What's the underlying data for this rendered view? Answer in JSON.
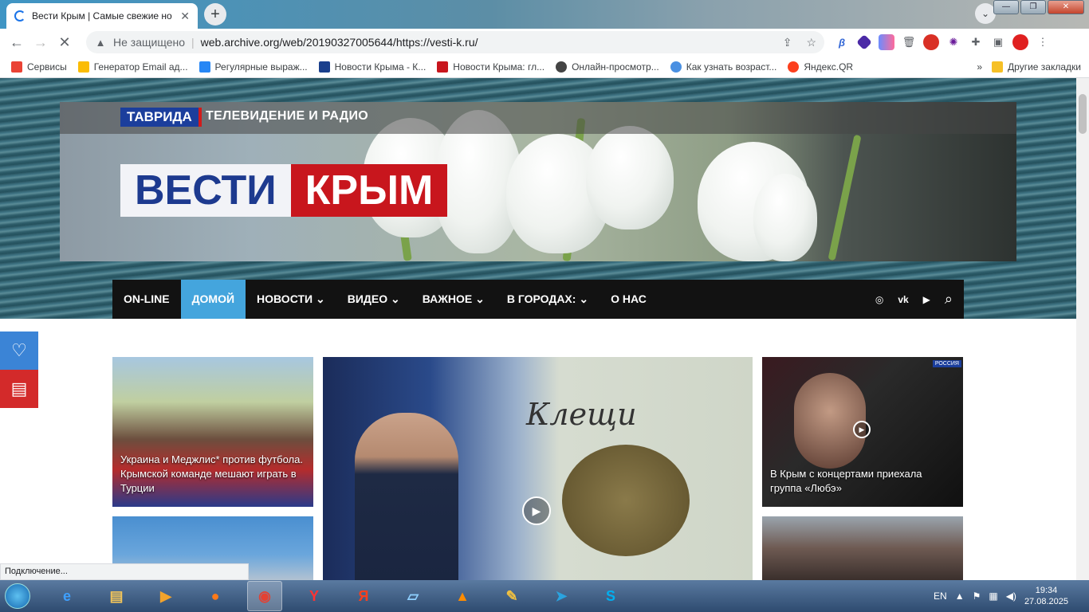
{
  "browser": {
    "tab_title": "Вести Крым | Самые свежие но",
    "address_warning": "Не защищено",
    "url": "web.archive.org/web/20190327005644/https://vesti-k.ru/",
    "status": "Подключение..."
  },
  "bookmarks": {
    "items": [
      {
        "label": "Сервисы",
        "color": "#ea4335"
      },
      {
        "label": "Генератор Email ад...",
        "color": "#fbbc05"
      },
      {
        "label": "Регулярные выраж...",
        "color": "#2787f5"
      },
      {
        "label": "Новости Крыма - К...",
        "color": "#1a3f8c"
      },
      {
        "label": "Новости Крыма: гл...",
        "color": "#c8161d"
      },
      {
        "label": "Онлайн-просмотр...",
        "color": "#444444"
      },
      {
        "label": "Как узнать возраст...",
        "color": "#4a90e2"
      },
      {
        "label": "Яндекс.QR",
        "color": "#fc3f1d"
      }
    ],
    "more": "»",
    "other": "Другие закладки"
  },
  "site": {
    "brand_taurida": "ТАВРИДА",
    "brand_tv": "ТЕЛЕВИДЕНИЕ И РАДИО",
    "logo_vesti": "ВЕСТИ",
    "logo_krym": "КРЫМ",
    "menu": [
      {
        "label": "ON-LINE",
        "dropdown": ""
      },
      {
        "label": "ДОМОЙ",
        "dropdown": ""
      },
      {
        "label": "НОВОСТИ",
        "dropdown": "⌄"
      },
      {
        "label": "ВИДЕО",
        "dropdown": "⌄"
      },
      {
        "label": "ВАЖНОЕ",
        "dropdown": "⌄"
      },
      {
        "label": "В ГОРОДАХ:",
        "dropdown": "⌄"
      },
      {
        "label": "О НАС",
        "dropdown": ""
      }
    ],
    "main_video_text": "Клещи",
    "cards": {
      "football": "Украина и Меджлис* против футбола. Крымской команде мешают играть в Турции",
      "lube": "В Крым с концертами приехала группа «Любэ»"
    },
    "channel_badge": "РОССИЯ"
  },
  "taskbar": {
    "lang": "EN",
    "time": "19:34",
    "date": "27.08.2025"
  }
}
